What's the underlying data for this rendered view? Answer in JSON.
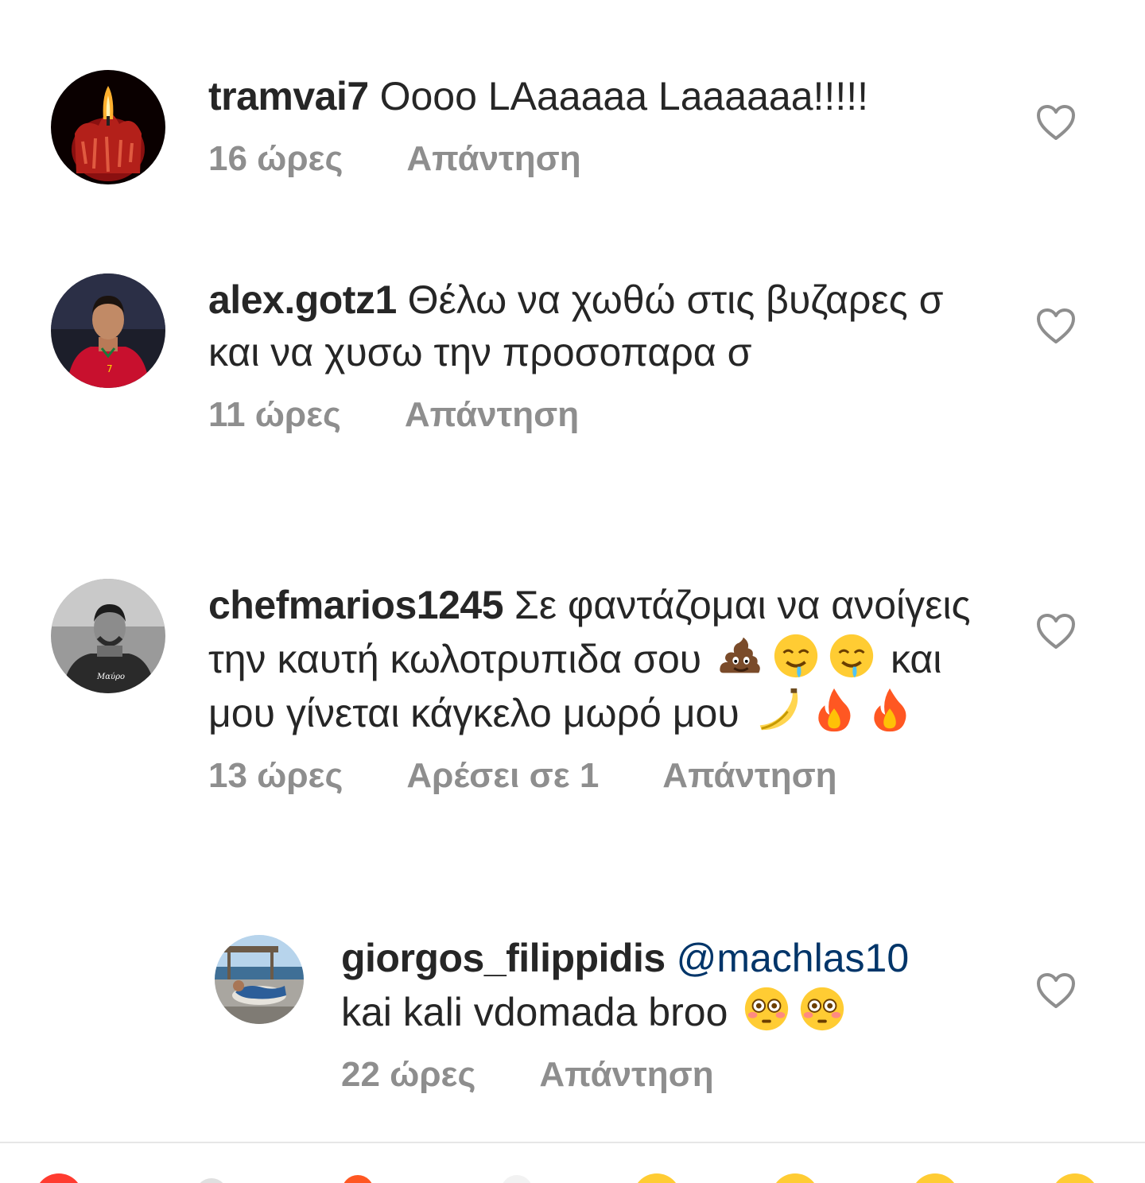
{
  "comments": [
    {
      "username": "tramvai7",
      "text": " Oooo LAaaaaa Laaaaaa!!!!!",
      "time": "16 ώρες",
      "reply": "Απάντηση"
    },
    {
      "username": "alex.gotz1",
      "text": " Θέλω να χωθώ στις βυζαρες σ και να χυσω την προσοπαρα σ",
      "time": "11 ώρες",
      "reply": "Απάντηση"
    },
    {
      "username": "chefmarios1245",
      "text_a": " Σε φαντάζομαι να ανοίγεις την καυτή κωλοτρυπιδα σου",
      "text_b": " και μου γίνεται κάγκελο μωρό μου",
      "time": "13 ώρες",
      "likes": "Αρέσει σε 1",
      "reply": "Απάντηση",
      "emojis_a": [
        "poop-emoji",
        "drooling-face-emoji",
        "drooling-face-emoji"
      ],
      "emojis_b": [
        "banana-emoji",
        "fire-emoji",
        "fire-emoji"
      ]
    },
    {
      "username": "giorgos_filippidis",
      "mention": "@machlas10",
      "text": "kai kali vdomada broo",
      "time": "22 ώρες",
      "reply": "Απάντηση",
      "emojis": [
        "flushed-face-emoji",
        "flushed-face-emoji"
      ]
    }
  ],
  "colors": {
    "text": "#262626",
    "meta": "#8e8e8e",
    "mention": "#003569",
    "heart": "#8e8e8e"
  },
  "icons": {
    "like": "heart-outline-icon"
  }
}
